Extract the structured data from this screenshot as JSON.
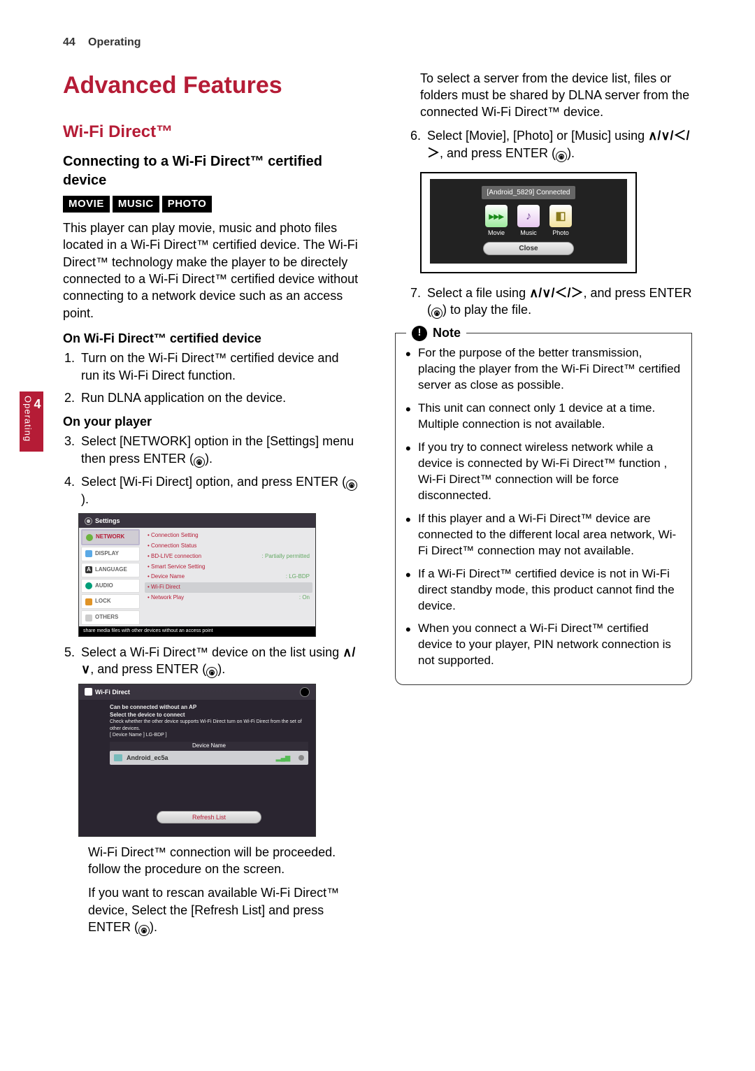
{
  "page": {
    "number": "44",
    "section": "Operating"
  },
  "side_tab": {
    "number": "4",
    "label": "Operating"
  },
  "headings": {
    "h1": "Advanced Features",
    "h2": "Wi-Fi Direct™",
    "h3": "Connecting to a Wi-Fi Direct™ certified device"
  },
  "badges": [
    "MOVIE",
    "MUSIC",
    "PHOTO"
  ],
  "intro": "This player can play movie, music and photo files located in a Wi-Fi Direct™ certified device. The Wi-Fi Direct™ technology make the player to be directely connected to a Wi-Fi Direct™ certified device without connecting to a network device such as an access point.",
  "sub": {
    "on_cert": "On Wi-Fi Direct™ certified device",
    "on_player": "On your player"
  },
  "steps": {
    "s1": "Turn on the Wi-Fi Direct™ certified device and run its Wi-Fi Direct function.",
    "s2": "Run DLNA application on the device.",
    "s3_a": "Select [NETWORK] option in the [Settings] menu then press ENTER (",
    "s3_b": ").",
    "s4_a": "Select [Wi-Fi Direct] option, and press ENTER (",
    "s4_b": ").",
    "s5_a": "Select a Wi-Fi Direct™ device on the list using ",
    "s5_nav": "∧/∨",
    "s5_b": ", and press ENTER (",
    "s5_c": ").",
    "s5_after1": "Wi-Fi Direct™ connection will be proceeded. follow the procedure on the screen.",
    "s5_after2_a": "If you want to rescan available Wi-Fi Direct™ device, Select the [Refresh List] and press ENTER (",
    "s5_after2_b": ").",
    "right_pre": "To select a server from the device list, files or folders must be shared by DLNA server from the connected Wi-Fi Direct™ device.",
    "s6_a": "Select [Movie], [Photo] or [Music] using ",
    "s6_nav": "∧/∨/＜/＞",
    "s6_b": ", and press ENTER (",
    "s6_c": ").",
    "s7_a": "Select a file using ",
    "s7_nav": "∧/∨/＜/＞",
    "s7_b": ", and press ENTER (",
    "s7_c": ") to play the file."
  },
  "settings_shot": {
    "title": "Settings",
    "side": [
      "NETWORK",
      "DISPLAY",
      "LANGUAGE",
      "AUDIO",
      "LOCK",
      "OTHERS"
    ],
    "rows": [
      {
        "label": "Connection Setting",
        "value": ""
      },
      {
        "label": "Connection Status",
        "value": ""
      },
      {
        "label": "BD-LIVE connection",
        "value": ": Partially permitted"
      },
      {
        "label": "Smart Service Setting",
        "value": ""
      },
      {
        "label": "Device Name",
        "value": ": LG-BDP"
      },
      {
        "label": "Wi-Fi Direct",
        "value": "",
        "sel": true
      },
      {
        "label": "Network Play",
        "value": ": On"
      }
    ],
    "footer": "share media files with other devices without an access point"
  },
  "wifi_shot": {
    "title": "Wi-Fi Direct",
    "line1": "Can be connected without an AP",
    "line2": "Select the device to connect",
    "line3": "Check whether the other device supports Wi-Fi Direct turn on Wi-Fi Direct from the set of other devices.",
    "line4": "[ Device Name ] LG-BDP ]",
    "devname_header": "Device Name",
    "device": "Android_ec5a",
    "refresh": "Refresh List"
  },
  "device_shot": {
    "connected": "[Android_5829] Connected",
    "icons": {
      "movie": "Movie",
      "music": "Music",
      "photo": "Photo"
    },
    "close": "Close"
  },
  "note": {
    "title": "Note",
    "items": [
      "For the purpose of the better transmission, placing the player from the Wi-Fi Direct™ certified server as close as possible.",
      "This unit can connect only 1 device at a time. Multiple connection is not available.",
      "If you try to connect wireless network while a device is connected by Wi-Fi Direct™ function , Wi-Fi Direct™ connection will be force disconnected.",
      "If this player and a Wi-Fi Direct™ device are connected to the different local area network, Wi-Fi Direct™ connection may not available.",
      "If a Wi-Fi Direct™ certified device is not in Wi-Fi direct standby mode, this product cannot find the device.",
      "When you connect a Wi-Fi Direct™ certified device to your player, PIN network connection is not supported."
    ]
  }
}
